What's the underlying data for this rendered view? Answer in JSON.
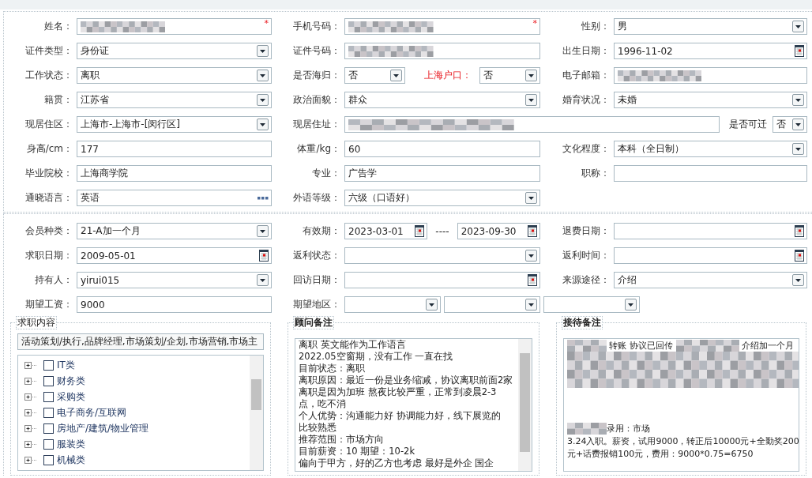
{
  "personal_section": {
    "rows": [
      {
        "cells": [
          {
            "label": "姓名：",
            "highlight": false,
            "fields": [
              {
                "kind": "blurred",
                "required_mark": "*"
              }
            ]
          },
          {
            "label": "手机号码：",
            "highlight": false,
            "fields": [
              {
                "kind": "blurred",
                "required_mark": "*"
              }
            ]
          },
          {
            "label": "性别：",
            "highlight": false,
            "fields": [
              {
                "kind": "select",
                "value": "男"
              }
            ]
          }
        ]
      },
      {
        "cells": [
          {
            "label": "证件类型：",
            "highlight": false,
            "fields": [
              {
                "kind": "select",
                "value": "身份证"
              }
            ]
          },
          {
            "label": "证件号码：",
            "highlight": false,
            "fields": [
              {
                "kind": "blurred"
              }
            ]
          },
          {
            "label": "出生日期：",
            "highlight": false,
            "fields": [
              {
                "kind": "date",
                "value": "1996-11-02"
              }
            ]
          }
        ]
      },
      {
        "cells": [
          {
            "label": "工作状态：",
            "highlight": false,
            "fields": [
              {
                "kind": "select",
                "value": "离职"
              }
            ]
          },
          {
            "label": "是否海归：",
            "highlight": false,
            "fields": [
              {
                "kind": "select",
                "value": "否"
              },
              {
                "kind": "label",
                "text": "上海户口：",
                "highlight": true
              },
              {
                "kind": "select",
                "value": "否"
              }
            ]
          },
          {
            "label": "电子邮箱：",
            "highlight": false,
            "fields": [
              {
                "kind": "blurred"
              }
            ]
          }
        ]
      },
      {
        "cells": [
          {
            "label": "籍贯：",
            "highlight": false,
            "fields": [
              {
                "kind": "select",
                "value": "江苏省"
              }
            ]
          },
          {
            "label": "政治面貌：",
            "highlight": false,
            "fields": [
              {
                "kind": "select",
                "value": "群众"
              }
            ]
          },
          {
            "label": "婚育状况：",
            "highlight": false,
            "fields": [
              {
                "kind": "select",
                "value": "未婚"
              }
            ]
          }
        ]
      },
      {
        "cells": [
          {
            "label": "现居住区：",
            "highlight": false,
            "fields": [
              {
                "kind": "select",
                "value": " 上海市-上海市-[闵行区]"
              }
            ]
          },
          {
            "label": "现居住址：",
            "highlight": false,
            "wide": true,
            "fields": [
              {
                "kind": "blurred"
              },
              {
                "kind": "label",
                "text": "是否可迁",
                "highlight": false
              },
              {
                "kind": "select",
                "value": "否"
              }
            ]
          }
        ]
      },
      {
        "cells": [
          {
            "label": "身高/cm：",
            "highlight": false,
            "fields": [
              {
                "kind": "text",
                "value": "177"
              }
            ]
          },
          {
            "label": "体重/kg：",
            "highlight": false,
            "fields": [
              {
                "kind": "text",
                "value": "60"
              }
            ]
          },
          {
            "label": "文化程度：",
            "highlight": false,
            "fields": [
              {
                "kind": "select",
                "value": "本科（全日制）"
              }
            ]
          }
        ]
      },
      {
        "cells": [
          {
            "label": "毕业院校：",
            "highlight": false,
            "fields": [
              {
                "kind": "text",
                "value": "上海商学院"
              }
            ]
          },
          {
            "label": "专业：",
            "highlight": false,
            "fields": [
              {
                "kind": "text",
                "value": "广告学"
              }
            ]
          },
          {
            "label": "职称：",
            "highlight": false,
            "fields": [
              {
                "kind": "text"
              }
            ]
          }
        ]
      },
      {
        "cells": [
          {
            "label": "通晓语言：",
            "highlight": false,
            "fields": [
              {
                "kind": "more",
                "value": "英语"
              }
            ]
          },
          {
            "label": "外语等级：",
            "highlight": false,
            "fields": [
              {
                "kind": "select",
                "value": "六级（口语好）"
              }
            ]
          }
        ]
      }
    ]
  },
  "membership_section": {
    "rows": [
      {
        "cells": [
          {
            "label": "会员种类：",
            "highlight": false,
            "fields": [
              {
                "kind": "select",
                "value": " 21-A加一个月"
              }
            ]
          },
          {
            "label": "有效期：",
            "highlight": false,
            "fields": [
              {
                "kind": "date",
                "value": "2023-03-01"
              },
              {
                "kind": "dash",
                "text": "----"
              },
              {
                "kind": "date",
                "value": "2023-09-30"
              }
            ]
          },
          {
            "label": "退费日期：",
            "highlight": false,
            "fields": [
              {
                "kind": "date"
              }
            ]
          }
        ]
      },
      {
        "cells": [
          {
            "label": "求职日期：",
            "highlight": false,
            "fields": [
              {
                "kind": "date",
                "value": "2009-05-01"
              }
            ]
          },
          {
            "label": "返利状态：",
            "highlight": false,
            "fields": [
              {
                "kind": "select"
              }
            ]
          },
          {
            "label": "返利时间：",
            "highlight": false,
            "fields": [
              {
                "kind": "date"
              }
            ]
          }
        ]
      },
      {
        "cells": [
          {
            "label": "持有人：",
            "highlight": false,
            "fields": [
              {
                "kind": "select",
                "value": "yirui015"
              }
            ]
          },
          {
            "label": "回访日期：",
            "highlight": false,
            "fields": [
              {
                "kind": "date"
              }
            ]
          },
          {
            "label": "来源途径：",
            "highlight": false,
            "fields": [
              {
                "kind": "select",
                "value": "介绍"
              }
            ]
          }
        ]
      },
      {
        "cells": [
          {
            "label": "期望工资：",
            "highlight": false,
            "fields": [
              {
                "kind": "text",
                "value": "9000"
              }
            ]
          },
          {
            "label": "期望地区：",
            "highlight": false,
            "wide": true,
            "fields": [
              {
                "kind": "select"
              },
              {
                "kind": "select"
              },
              {
                "kind": "select"
              }
            ]
          }
        ]
      }
    ],
    "job_group": {
      "title": "求职内容",
      "selected_text": "活动策划/执行,品牌经理,市场策划/企划,市场营销,市场主",
      "tree": [
        {
          "label": "IT类",
          "checked": false,
          "expanded": false
        },
        {
          "label": "财务类",
          "checked": false,
          "expanded": false
        },
        {
          "label": "采购类",
          "checked": false,
          "expanded": false
        },
        {
          "label": "电子商务/互联网",
          "checked": false,
          "expanded": false
        },
        {
          "label": "房地产/建筑/物业管理",
          "checked": false,
          "expanded": false
        },
        {
          "label": "服装类",
          "checked": false,
          "expanded": false
        },
        {
          "label": "机械类",
          "checked": false,
          "expanded": false
        }
      ]
    },
    "advisor_group": {
      "title": "顾问备注",
      "lines": [
        "离职 英文能作为工作语言",
        "2022.05空窗期，没有工作 一直在找",
        "目前状态：离职",
        "离职原因：最近一份是业务缩减，协议离职前面2家",
        "离职是因为加班  熬夜比较严重，正常到凌晨2-3",
        "点，吃不消",
        "个人优势：沟通能力好    协调能力好，线下展览的",
        "比较熟悉",
        "推荐范围：市场方向",
        "目前薪资：10   期望：10-2k",
        "偏向于甲方，好的乙方也考虑  最好是外企   国企"
      ]
    },
    "reception_group": {
      "title": "接待备注",
      "lines": [
        [
          {
            "kind": "blurred"
          },
          {
            "kind": "text",
            "text": " 转账 协议已回传 "
          },
          {
            "kind": "blurred"
          },
          {
            "kind": "text",
            "text": " 介绍加一个月"
          }
        ],
        [
          {
            "kind": "blurred_block"
          }
        ],
        [
          {
            "kind": "blurred"
          },
          {
            "kind": "text",
            "text": "录用：市场"
          }
        ],
        [
          {
            "kind": "text",
            "text": "3.24入职。薪资，试用9000，转正后10000元+全勤奖200"
          }
        ],
        [
          {
            "kind": "text",
            "text": "元+话费报销100元，费用：9000*0.75=6750"
          }
        ]
      ]
    }
  }
}
